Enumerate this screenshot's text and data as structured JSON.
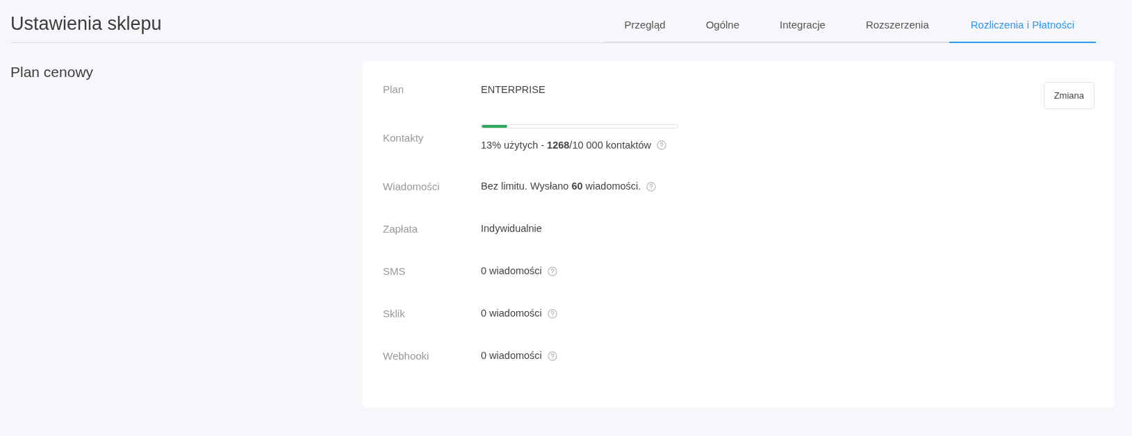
{
  "page": {
    "title": "Ustawienia sklepu"
  },
  "tabs": [
    {
      "label": "Przegląd",
      "selected": false
    },
    {
      "label": "Ogólne",
      "selected": false
    },
    {
      "label": "Integracje",
      "selected": false
    },
    {
      "label": "Rozszerzenia",
      "selected": false
    },
    {
      "label": "Rozliczenia i Płatności",
      "selected": true
    }
  ],
  "section": {
    "title": "Plan cenowy"
  },
  "change_button": "Zmiana",
  "rows": [
    {
      "kind": "text",
      "label": "Plan",
      "value": "ENTERPRISE",
      "help": false
    },
    {
      "kind": "progress",
      "label": "Kontakty",
      "level": 0.13,
      "value": "13% użytych - **1268**/10 000 kontaktów",
      "help": true
    },
    {
      "kind": "text",
      "label": "Wiadomości",
      "value": "Bez limitu. Wysłano **60** wiadomości.",
      "help": true
    },
    {
      "kind": "text",
      "label": "Zapłata",
      "value": "Indywidualnie",
      "help": false
    },
    {
      "kind": "text",
      "label": "SMS",
      "value": "0 wiadomości",
      "help": true
    },
    {
      "kind": "text",
      "label": "Sklik",
      "value": "0 wiadomości",
      "help": true
    },
    {
      "kind": "text",
      "label": "Webhooki",
      "value": "0 wiadomości",
      "help": true
    }
  ]
}
